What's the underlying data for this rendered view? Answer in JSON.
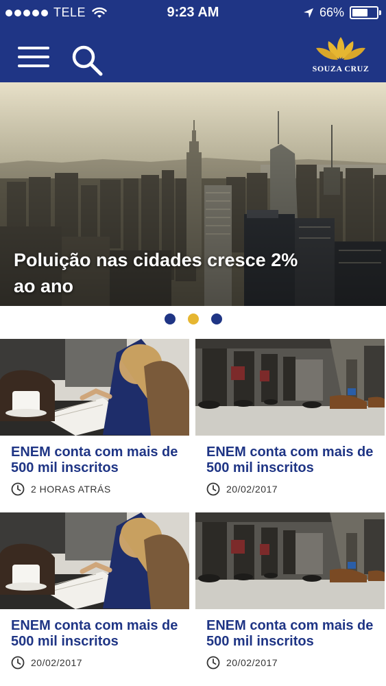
{
  "status_bar": {
    "carrier": "TELE",
    "time": "9:23 AM",
    "battery": "66%",
    "battery_level": 0.66,
    "icons": [
      "signal-dots",
      "wifi-icon",
      "location-icon",
      "battery-icon"
    ]
  },
  "nav": {
    "icons": [
      "menu-icon",
      "search-icon"
    ],
    "brand": "SOUZA CRUZ"
  },
  "hero": {
    "title": "Poluição nas cidades cresce 2% ao ano"
  },
  "pager": {
    "count": 3,
    "active_index": 1
  },
  "articles": [
    {
      "title": "ENEM conta com mais de 500 mil inscritos",
      "meta": "2 HORAS ATRÁS"
    },
    {
      "title": "ENEM conta com mais de 500 mil inscritos",
      "meta": "20/02/2017"
    },
    {
      "title": "ENEM conta com mais de 500 mil inscritos",
      "meta": "20/02/2017"
    },
    {
      "title": "ENEM conta com mais de 500 mil inscritos",
      "meta": "20/02/2017"
    }
  ],
  "colors": {
    "brand_blue": "#1f3585",
    "accent_gold": "#e6b631",
    "text_dark": "#333333"
  }
}
